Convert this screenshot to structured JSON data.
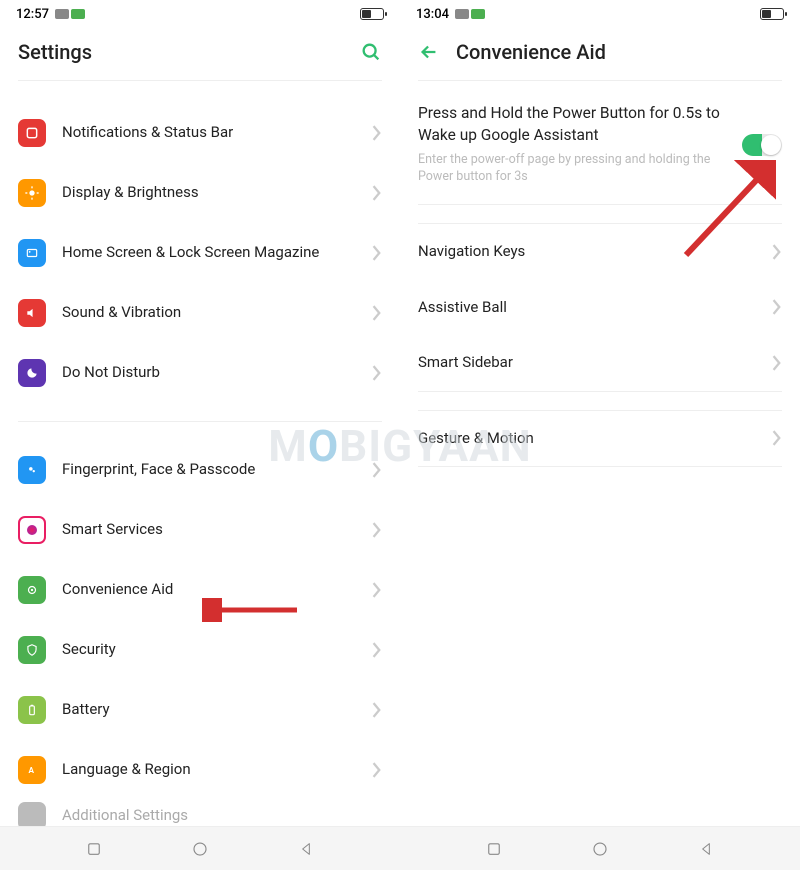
{
  "left_screen": {
    "status_time": "12:57",
    "header_title": "Settings",
    "items": [
      {
        "label": "Notifications & Status Bar",
        "icon_color": "#e53935"
      },
      {
        "label": "Display & Brightness",
        "icon_color": "#ff9800"
      },
      {
        "label": "Home Screen & Lock Screen Magazine",
        "icon_color": "#2196f3"
      },
      {
        "label": "Sound & Vibration",
        "icon_color": "#e53935"
      },
      {
        "label": "Do Not Disturb",
        "icon_color": "#5e35b1"
      }
    ],
    "items2": [
      {
        "label": "Fingerprint, Face & Passcode",
        "icon_color": "#2196f3"
      },
      {
        "label": "Smart Services",
        "icon_color": "#e91e63"
      },
      {
        "label": "Convenience Aid",
        "icon_color": "#4caf50"
      },
      {
        "label": "Security",
        "icon_color": "#4caf50"
      },
      {
        "label": "Battery",
        "icon_color": "#8bc34a"
      },
      {
        "label": "Language & Region",
        "icon_color": "#ff9800"
      },
      {
        "label": "Additional Settings",
        "icon_color": "#bbb"
      }
    ]
  },
  "right_screen": {
    "status_time": "13:04",
    "header_title": "Convenience Aid",
    "toggle": {
      "title": "Press and Hold the Power Button for 0.5s to Wake up Google Assistant",
      "subtitle": "Enter the power-off page by pressing and holding the Power button for 3s"
    },
    "group1": [
      {
        "label": "Navigation Keys"
      },
      {
        "label": "Assistive Ball"
      },
      {
        "label": "Smart Sidebar"
      }
    ],
    "group2": [
      {
        "label": "Gesture & Motion"
      }
    ]
  },
  "watermark": {
    "pre": "M",
    "accent": "O",
    "post": "BIGYAAN"
  }
}
